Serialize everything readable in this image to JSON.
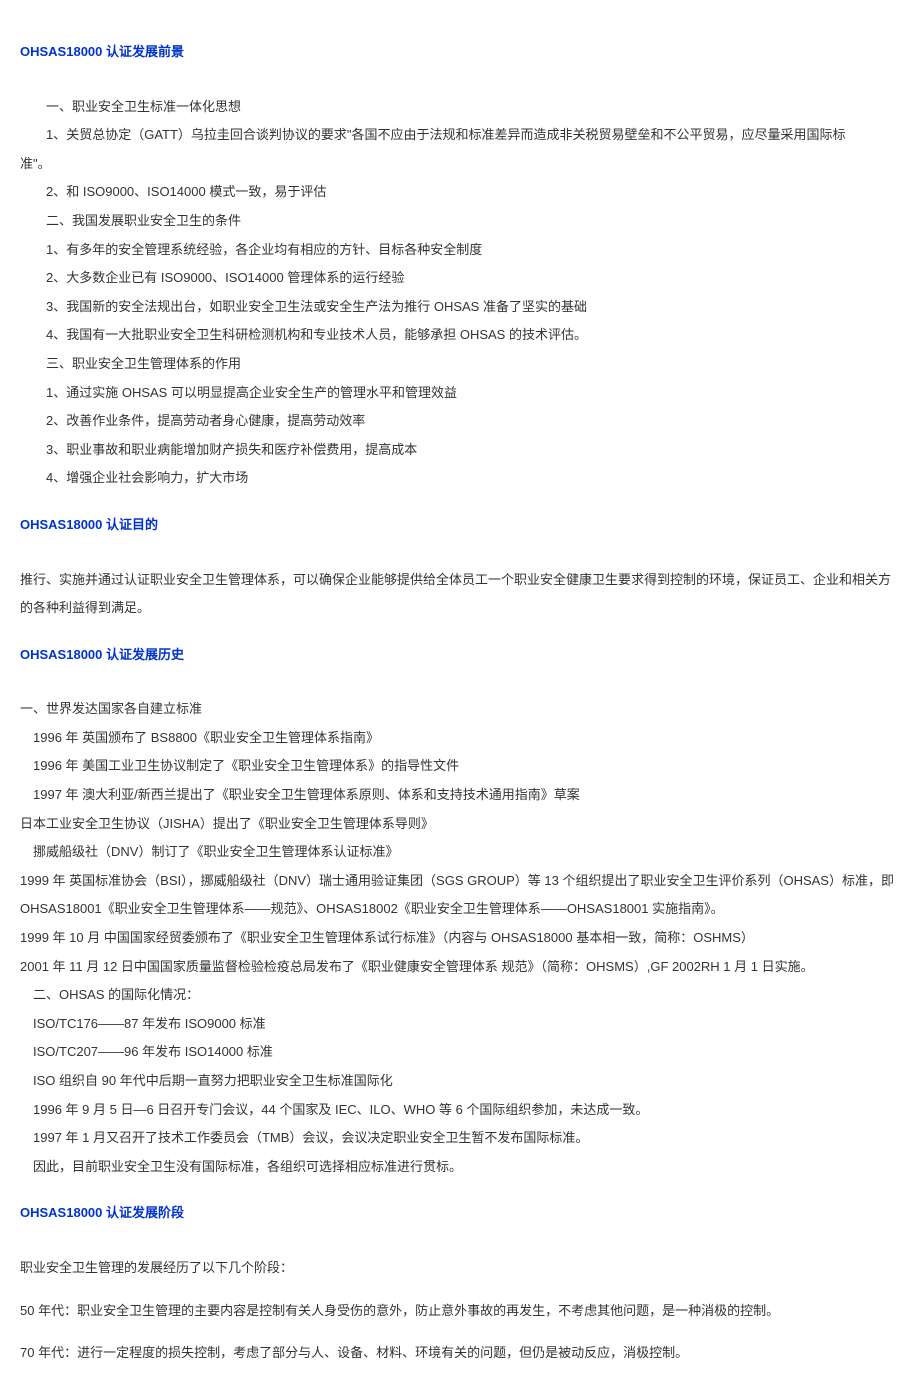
{
  "sections": {
    "prospects": {
      "heading": "OHSAS18000 认证发展前景",
      "lines": [
        "一、职业安全卫生标准一体化思想",
        "1、关贸总协定（GATT）乌拉圭回合谈判协议的要求\"各国不应由于法规和标准差异而造成非关税贸易壁垒和不公平贸易，应尽量采用国际标",
        "准\"。",
        "2、和 ISO9000、ISO14000 模式一致，易于评估",
        "二、我国发展职业安全卫生的条件",
        "1、有多年的安全管理系统经验，各企业均有相应的方针、目标各种安全制度",
        "2、大多数企业已有 ISO9000、ISO14000 管理体系的运行经验",
        "3、我国新的安全法规出台，如职业安全卫生法或安全生产法为推行 OHSAS 准备了坚实的基础",
        "4、我国有一大批职业安全卫生科研检测机构和专业技术人员，能够承担 OHSAS 的技术评估。",
        "三、职业安全卫生管理体系的作用",
        "1、通过实施 OHSAS 可以明显提高企业安全生产的管理水平和管理效益",
        "2、改善作业条件，提高劳动者身心健康，提高劳动效率",
        "3、职业事故和职业病能增加财产损失和医疗补偿费用，提高成本",
        "4、增强企业社会影响力，扩大市场"
      ]
    },
    "purpose": {
      "heading": "OHSAS18000 认证目的",
      "text": "推行、实施并通过认证职业安全卫生管理体系，可以确保企业能够提供给全体员工一个职业安全健康卫生要求得到控制的环境，保证员工、企业和相关方的各种利益得到满足。"
    },
    "history": {
      "heading": "OHSAS18000 认证发展历史",
      "lines": [
        "一、世界发达国家各自建立标准",
        "1996 年 英国颁布了 BS8800《职业安全卫生管理体系指南》",
        "1996 年 美国工业卫生协议制定了《职业安全卫生管理体系》的指导性文件",
        "1997 年 澳大利亚/新西兰提出了《职业安全卫生管理体系原则、体系和支持技术通用指南》草案",
        "日本工业安全卫生协议（JISHA）提出了《职业安全卫生管理体系导则》",
        "挪威船级社（DNV）制订了《职业安全卫生管理体系认证标准》",
        "1999 年 英国标准协会（BSI），挪威船级社（DNV）瑞士通用验证集团（SGS GROUP）等 13 个组织提出了职业安全卫生评价系列（OHSAS）标准，即 OHSAS18001《职业安全卫生管理体系——规范》、OHSAS18002《职业安全卫生管理体系——OHSAS18001 实施指南》。",
        "1999 年 10 月 中国国家经贸委颁布了《职业安全卫生管理体系试行标准》（内容与 OHSAS18000 基本相一致，简称：OSHMS）",
        "2001 年 11 月 12 日中国国家质量监督检验检疫总局发布了《职业健康安全管理体系 规范》（简称：OHSMS）,GF 2002RH 1 月 1 日实施。",
        "二、OHSAS 的国际化情况：",
        "ISO/TC176——87 年发布 ISO9000 标准",
        "ISO/TC207——96 年发布 ISO14000 标准",
        "ISO 组织自 90 年代中后期一直努力把职业安全卫生标准国际化",
        "1996 年 9 月 5 日—6 日召开专门会议，44 个国家及 IEC、ILO、WHO 等 6 个国际组织参加，未达成一致。",
        "1997 年 1 月又召开了技术工作委员会（TMB）会议，会议决定职业安全卫生暂不发布国际标准。",
        "因此，目前职业安全卫生没有国际标准，各组织可选择相应标准进行贯标。"
      ],
      "indents": [
        "none",
        "half",
        "half",
        "half",
        "none",
        "half",
        "none",
        "none",
        "none",
        "half",
        "half",
        "half",
        "half",
        "half",
        "half",
        "half"
      ]
    },
    "phases": {
      "heading": "OHSAS18000 认证发展阶段",
      "lines": [
        "职业安全卫生管理的发展经历了以下几个阶段：",
        "50 年代：职业安全卫生管理的主要内容是控制有关人身受伤的意外，防止意外事故的再发生，不考虑其他问题，是一种消极的控制。",
        "70 年代：进行一定程度的损失控制，考虑了部分与人、设备、材料、环境有关的问题，但仍是被动反应，消极控制。"
      ]
    }
  }
}
